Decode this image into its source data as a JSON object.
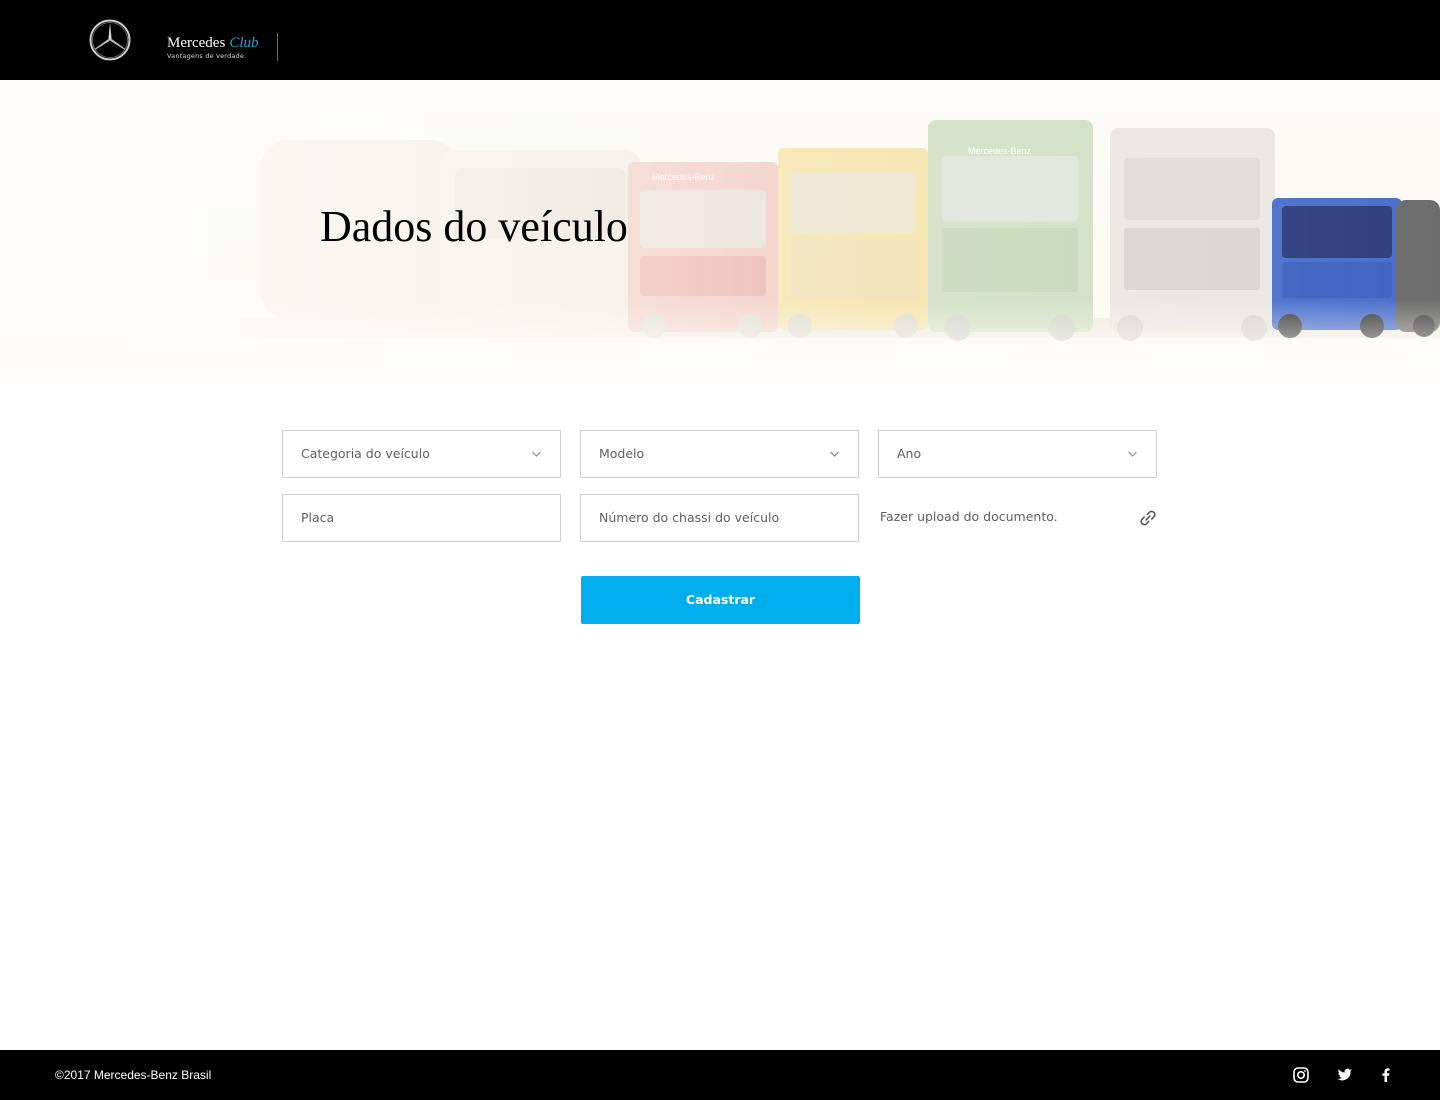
{
  "header": {
    "logo_icon": "mercedes-star-icon",
    "brand_name": "Mercedes",
    "brand_sub": "Club",
    "brand_tagline": "Vantagens de verdade."
  },
  "hero": {
    "title": "Dados do veículo",
    "truck_grille_text": "Mercedes-Benz"
  },
  "form": {
    "category_select": "Categoria do veículo",
    "model_select": "Modelo",
    "year_select": "Ano",
    "plate_placeholder": "Placa",
    "chassis_placeholder": "Número do chassi do veículo",
    "upload_label": "Fazer upload do documento.",
    "upload_icon": "paperclip-icon",
    "submit_label": "Cadastrar"
  },
  "footer": {
    "copyright": "©2017 Mercedes-Benz Brasil",
    "social": [
      "instagram-icon",
      "twitter-icon",
      "facebook-icon"
    ]
  },
  "colors": {
    "header_bg": "#000000",
    "accent": "#00aded",
    "club_blue": "#1ea5e0",
    "border": "#cfcfcf",
    "label_text": "#5f5f5f"
  }
}
